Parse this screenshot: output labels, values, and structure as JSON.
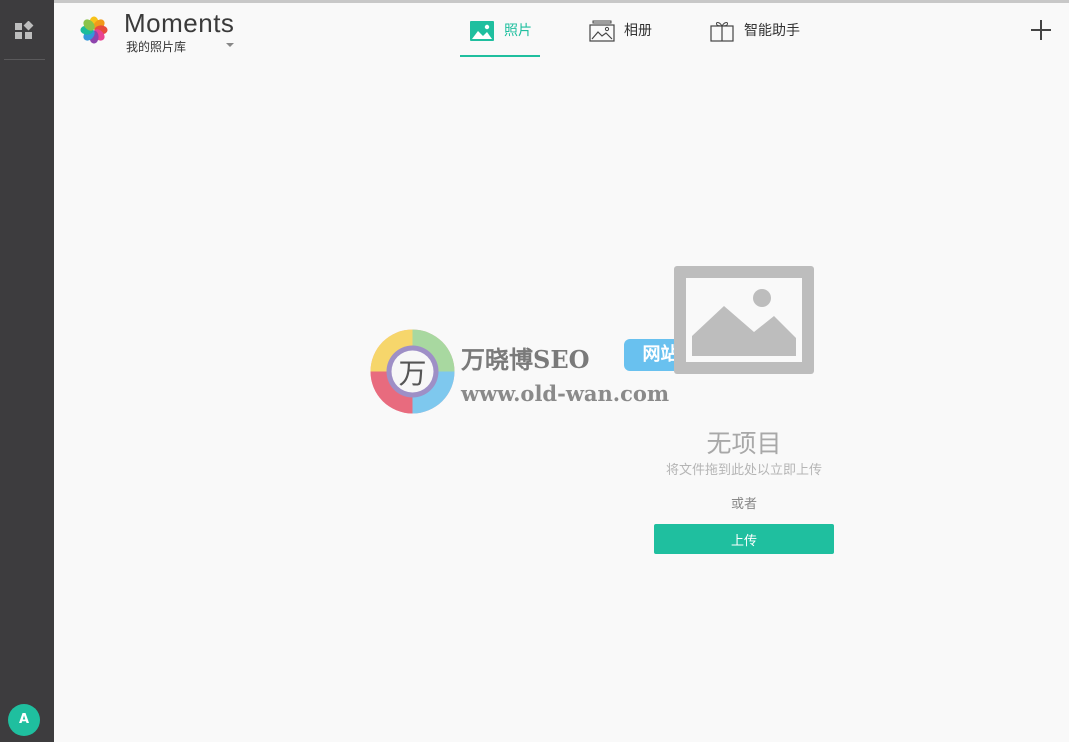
{
  "header": {
    "app_title": "Moments",
    "library_label": "我的照片库",
    "tabs": [
      {
        "label": "照片",
        "icon": "photo-icon",
        "active": true
      },
      {
        "label": "相册",
        "icon": "album-icon",
        "active": false
      },
      {
        "label": "智能助手",
        "icon": "gift-icon",
        "active": false
      }
    ]
  },
  "rail": {
    "avatar_initial": "A"
  },
  "empty_state": {
    "title": "无项目",
    "hint": "将文件拖到此处以立即上传",
    "or_text": "或者",
    "upload_label": "上传"
  },
  "watermark": {
    "glyph": "万",
    "title": "万晓博SEO",
    "badge": "网站",
    "url": "www.old-wan.com"
  },
  "colors": {
    "accent": "#1fbf9f",
    "rail_bg": "#3d3c3e",
    "page_bg": "#f9f9f9",
    "placeholder_gray": "#bdbdbd",
    "watermark_badge": "#69c1ef"
  }
}
